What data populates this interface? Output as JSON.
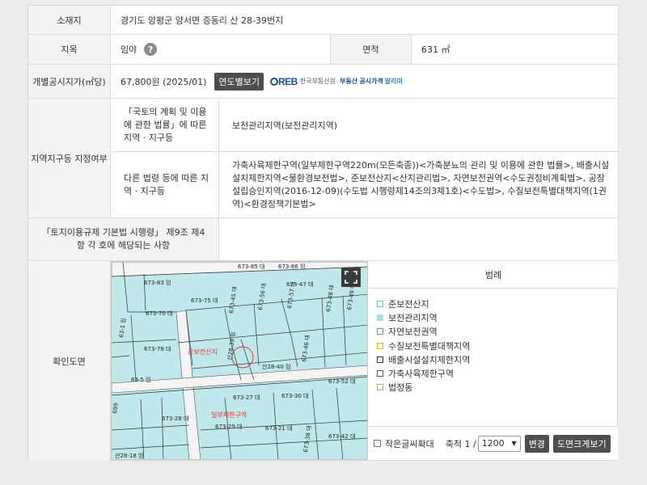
{
  "location": {
    "label": "소재지",
    "value": "경기도 양평군 양서면 증동리 산 28-39번지"
  },
  "land_category": {
    "label": "지목",
    "value": "임야",
    "help": "?"
  },
  "area": {
    "label": "면적",
    "value": "631 ㎡"
  },
  "price": {
    "label": "개별공시지가(㎡당)",
    "value": "67,800원 (2025/01)",
    "button": "연도별보기",
    "logo_mark": "REB",
    "logo_org": "한국부동산원",
    "logo_sub": "부동산 공시가격",
    "logo_sub2": "알리미"
  },
  "zoning": {
    "label": "지역지구등 지정여부",
    "national_label": "「국토의 계획 및 이용에 관한 법률」에 따른 지역 · 지구등",
    "national_value": "보전관리지역(보전관리지역)",
    "other_label": "다른 법령 등에 따른 지역 · 지구등",
    "other_value": "가축사육제한구역(일부제한구역220m(모든축종))<가축분뇨의 관리 및 이용에 관한 법률>, 배출시설설치제한지역<물환경보전법>, 준보전산지<산지관리법>, 자연보전권역<수도권정비계획법>, 공장설립승인지역(2016-12-09)(수도법 시행령제14조의3제1호)<수도법>, 수질보전특별대책지역(1권역)<환경정책기본법>"
  },
  "regulation": {
    "label": "「토지이용규제 기본법 시행령」 제9조 제4항 각 호에 해당되는 사항",
    "value": ""
  },
  "map": {
    "label": "확인도면",
    "legend_title": "범례",
    "legend": [
      {
        "label": "준보전산지",
        "color": "#58c8c8",
        "fill": "#ffffff"
      },
      {
        "label": "보전관리지역",
        "color": "#a6e2e4",
        "fill": "#a6e2e4"
      },
      {
        "label": "자연보전권역",
        "color": "#888888",
        "fill": "#ffffff"
      },
      {
        "label": "수질보전특별대책지역",
        "color": "#d8c400",
        "fill": "#ffffff"
      },
      {
        "label": "배출시설설치제한지역",
        "color": "#2b2b8c",
        "fill": "#ffffff"
      },
      {
        "label": "가축사육제한구역",
        "color": "#555555",
        "fill": "#ffffff"
      },
      {
        "label": "법정동",
        "color": "#c0a870",
        "fill": "#ffffff"
      }
    ],
    "small_text_label": "작은글씨확대",
    "scale_label": "축척 1 /",
    "scale_value": "1200",
    "change_button": "변경",
    "large_view_button": "도면크게보기",
    "lots": [
      {
        "label": "673-85 대"
      },
      {
        "label": "673-86 임"
      },
      {
        "label": "673-83 임"
      },
      {
        "label": "673-75 대"
      },
      {
        "label": "673-45 대"
      },
      {
        "label": "673-56 대"
      },
      {
        "label": "673-57 대"
      },
      {
        "label": "673-47 대"
      },
      {
        "label": "673-70 대"
      },
      {
        "label": "673-48 대"
      },
      {
        "label": "673-49 대"
      },
      {
        "label": "673-78 대"
      },
      {
        "label": "산28-40 임"
      },
      {
        "label": "산28-39 임"
      },
      {
        "label": "673-52 대"
      },
      {
        "label": "673-46 대"
      },
      {
        "label": "673-28 대"
      },
      {
        "label": "673-29 대"
      },
      {
        "label": "673-21 대"
      },
      {
        "label": "673-42 대"
      },
      {
        "label": "673-27 대"
      },
      {
        "label": "673-30 대"
      },
      {
        "label": "63-5 임"
      },
      {
        "label": "63-1 임"
      },
      {
        "label": "산28-18 임"
      },
      {
        "label": "673-38 대"
      },
      {
        "label": "699"
      }
    ],
    "zone_labels": [
      "준보전산지",
      "일부제한구역"
    ]
  }
}
